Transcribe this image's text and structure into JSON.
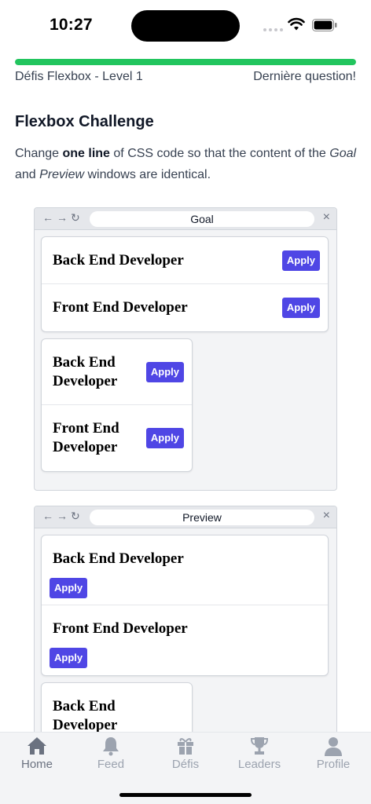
{
  "status": {
    "time": "10:27"
  },
  "progress": {
    "fraction": 1.0,
    "left_label": "Défis Flexbox - Level 1",
    "right_label": "Dernière question!",
    "color": "#22c55e"
  },
  "challenge": {
    "title": "Flexbox Challenge",
    "desc_1": "Change ",
    "desc_bold": "one line",
    "desc_2": " of CSS code so that the content of the ",
    "desc_goal": "Goal",
    "desc_3": " and ",
    "desc_preview": "Preview",
    "desc_4": " windows are identical."
  },
  "goal_window": {
    "title": "Goal",
    "full_cards": [
      {
        "title": "Back End Developer",
        "button": "Apply"
      },
      {
        "title": "Front End Developer",
        "button": "Apply"
      }
    ],
    "half_cards": [
      {
        "title": "Back End Developer",
        "button": "Apply"
      },
      {
        "title": "Front End Developer",
        "button": "Apply"
      }
    ]
  },
  "preview_window": {
    "title": "Preview",
    "full_cards": [
      {
        "title": "Back End Developer",
        "button": "Apply"
      },
      {
        "title": "Front End Developer",
        "button": "Apply"
      }
    ],
    "half_cards": [
      {
        "title": "Back End Developer"
      }
    ]
  },
  "tabs": [
    {
      "label": "Home",
      "icon": "home-icon",
      "active": true
    },
    {
      "label": "Feed",
      "icon": "bell-icon",
      "active": false
    },
    {
      "label": "Défis",
      "icon": "gift-icon",
      "active": false
    },
    {
      "label": "Leaders",
      "icon": "trophy-icon",
      "active": false
    },
    {
      "label": "Profile",
      "icon": "person-icon",
      "active": false
    }
  ],
  "colors": {
    "accent": "#4f46e5",
    "tab_active": "#6b7280",
    "tab_inactive": "#9ca3af"
  }
}
